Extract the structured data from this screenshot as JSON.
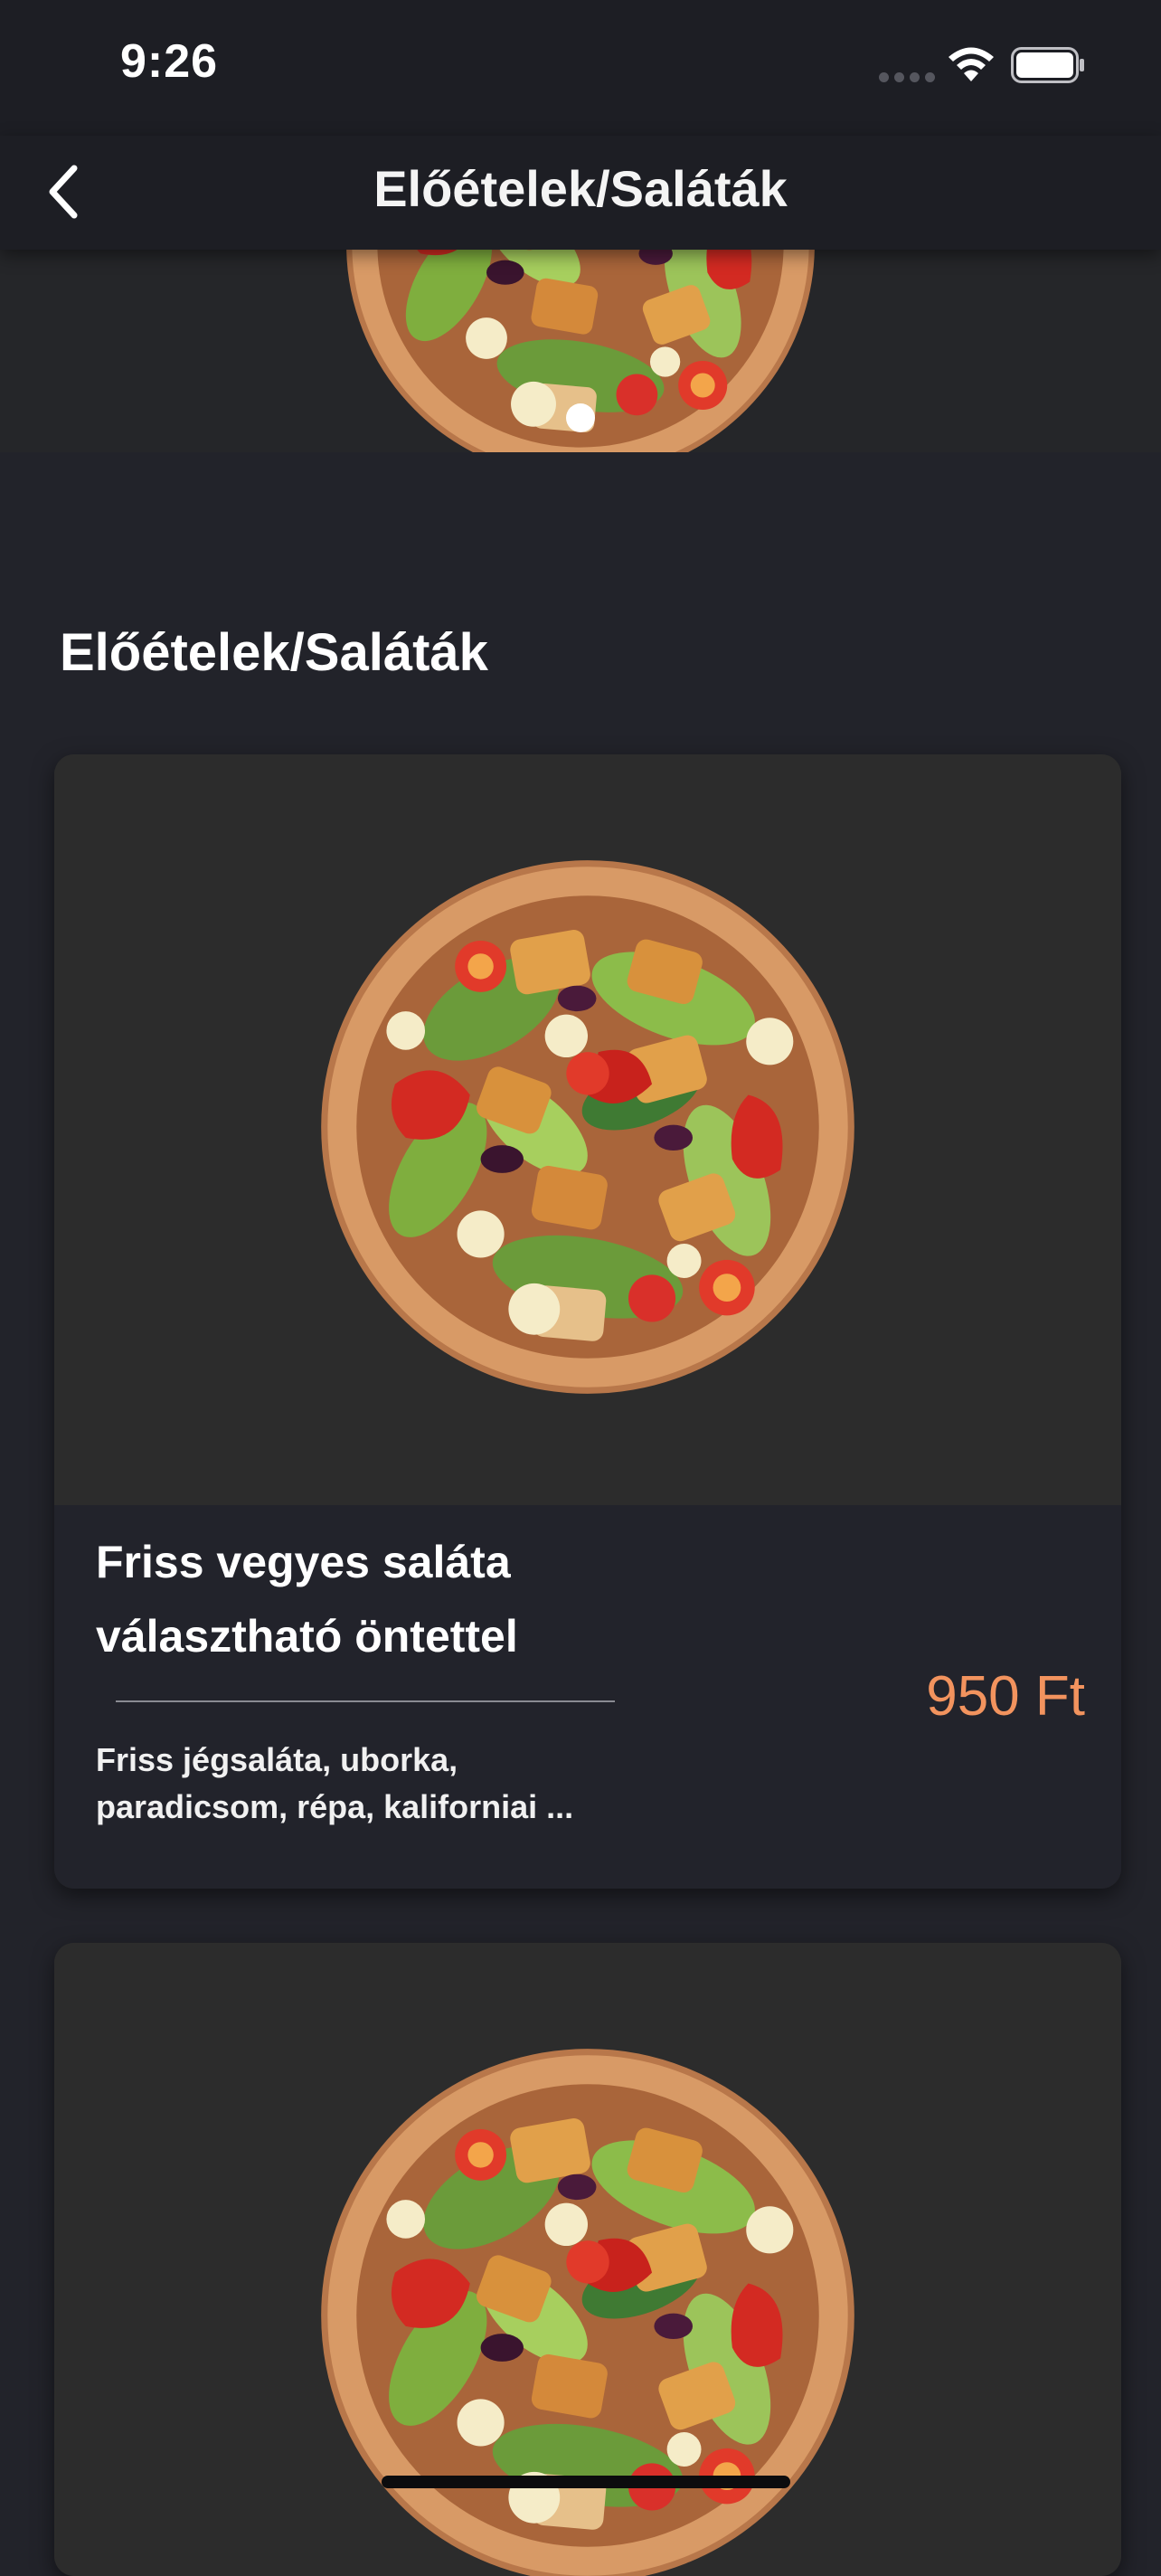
{
  "status_bar": {
    "time": "9:26"
  },
  "nav": {
    "title": "Előételek/Saláták",
    "back_icon": "chevron-left-icon"
  },
  "carousel": {
    "image": "salad-bowl-image",
    "page_count": 1,
    "active_page": 1
  },
  "section": {
    "title": "Előételek/Saláták"
  },
  "products": [
    {
      "name_line1": "Friss vegyes saláta",
      "name_line2": "választható öntettel",
      "description_line1": "Friss jégsaláta, uborka,",
      "description_line2": "paradicsom, répa, kaliforniai ...",
      "price": "950 Ft",
      "image": "salad-bowl-image"
    },
    {
      "image": "salad-bowl-image"
    }
  ],
  "colors": {
    "background": "#22232a",
    "card_image_bg": "#2c2c2c",
    "card_info_bg": "#22232b",
    "price": "#f2935e",
    "text": "#ffffff"
  }
}
